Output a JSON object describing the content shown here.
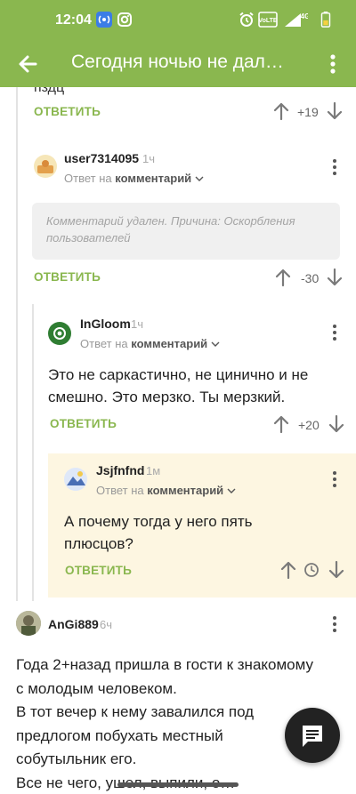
{
  "status_bar": {
    "time": "12:04",
    "icons": [
      "wifi-calling-icon",
      "instagram-icon",
      "alarm-icon",
      "volte-icon",
      "signal-icon",
      "battery-icon"
    ],
    "volte_label": "VoLTE",
    "network_label": "4G"
  },
  "app_bar": {
    "title": "Сегодня ночью не дал…",
    "colors": {
      "bar": "#8ab74f",
      "accent": "#8ab74f"
    }
  },
  "top_partial": {
    "text_fragment": "пздц",
    "reply_label": "ОТВЕТИТЬ",
    "score": "+19"
  },
  "comments": [
    {
      "username": "user7314095",
      "age": "1ч",
      "reply_to_prefix": "Ответ на",
      "reply_to_target": "комментарий",
      "deleted_notice": "Комментарий удален. Причина: Оскорбления пользователей",
      "reply_label": "ОТВЕТИТЬ",
      "score": "-30"
    },
    {
      "username": "InGloom",
      "age": "1ч",
      "reply_to_prefix": "Ответ на",
      "reply_to_target": "комментарий",
      "text": "Это не саркастично, не цинично и не смешно. Это мерзко. Ты мерзкий.",
      "reply_label": "ОТВЕТИТЬ",
      "score": "+20"
    },
    {
      "username": "Jsjfnfnd",
      "age": "1м",
      "reply_to_prefix": "Ответ на",
      "reply_to_target": "комментарий",
      "text": "А почему тогда у него пять плюсцов?",
      "reply_label": "ОТВЕТИТЬ",
      "score_state": "pending-clock-icon"
    },
    {
      "username": "AnGi889",
      "age": "6ч",
      "text_lines": [
        "Года 2+назад пришла в гости к знакомому",
        "с молодым человеком.",
        "В тот вечер к нему завалился под",
        "предлогом побухать местный",
        "собутыльник его.",
        "Все не чего, ушел, выпили, о…"
      ]
    }
  ],
  "fab": {
    "icon": "comment-icon"
  }
}
